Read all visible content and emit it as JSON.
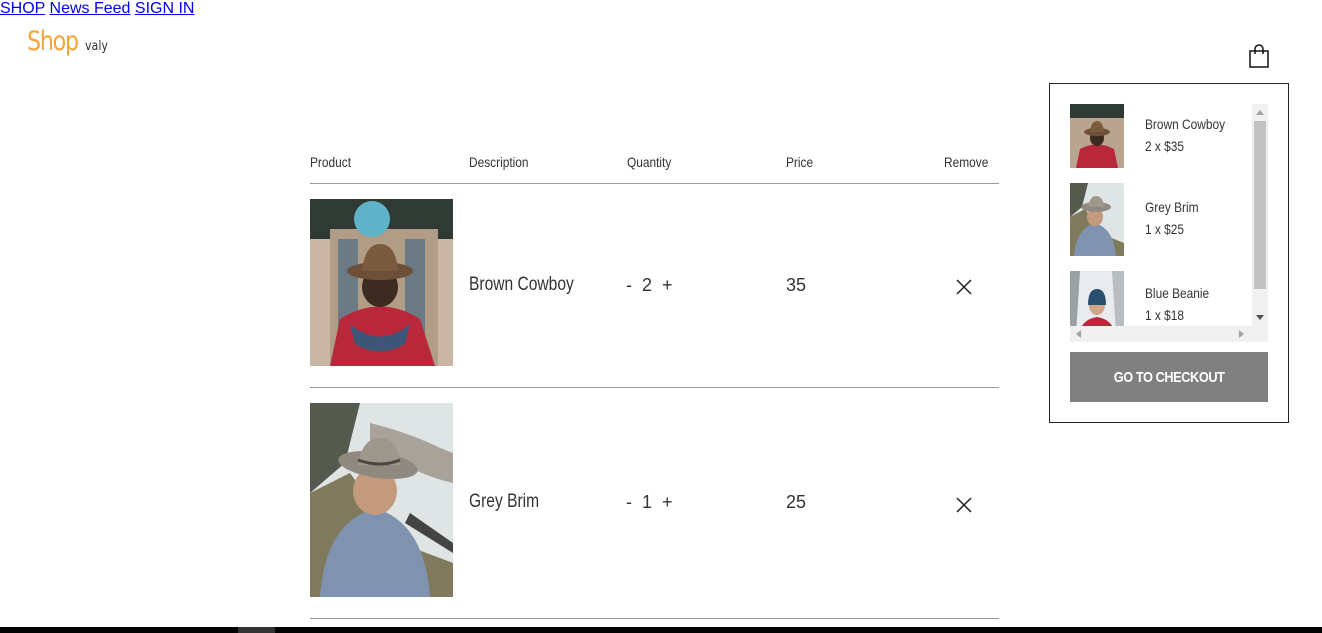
{
  "brand": {
    "name": "Shop",
    "sub": "valy",
    "color": "#f3a43b"
  },
  "nav": {
    "shop": "SHOP",
    "news_feed": "News Feed",
    "sign_in": "SIGN IN",
    "cart_icon": "shopping-bag-icon"
  },
  "table": {
    "headers": {
      "product": "Product",
      "description": "Description",
      "quantity": "Quantity",
      "price": "Price",
      "remove": "Remove"
    },
    "rows": [
      {
        "name": "Brown Cowboy",
        "qty": "2",
        "price": "35",
        "minus": "-",
        "plus": "+"
      },
      {
        "name": "Grey Brim",
        "qty": "1",
        "price": "25",
        "minus": "-",
        "plus": "+"
      }
    ]
  },
  "minicart": {
    "items": [
      {
        "name": "Brown Cowboy",
        "qty_price": "2 x $35"
      },
      {
        "name": "Grey Brim",
        "qty_price": "1 x $25"
      },
      {
        "name": "Blue Beanie",
        "qty_price": "1 x $18"
      }
    ],
    "checkout_label": "GO TO CHECKOUT",
    "checkout_color": "#808080"
  }
}
